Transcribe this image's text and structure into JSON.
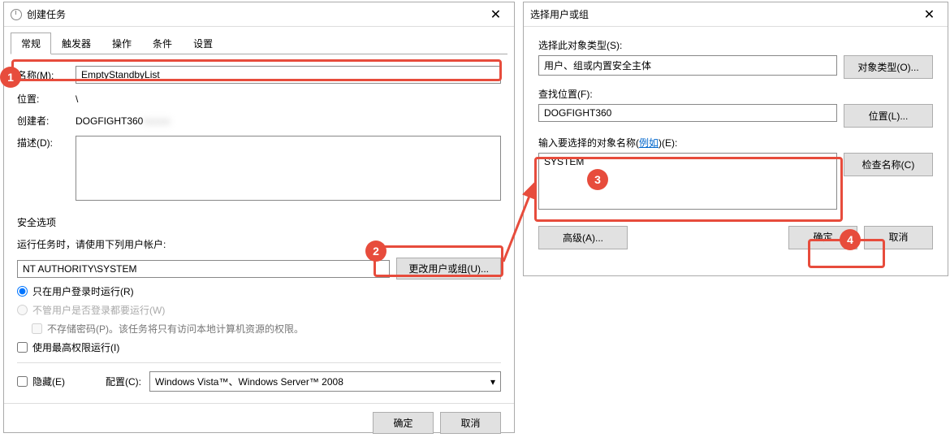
{
  "window1": {
    "title": "创建任务",
    "tabs": [
      "常规",
      "触发器",
      "操作",
      "条件",
      "设置"
    ],
    "labels": {
      "name": "名称(M):",
      "location": "位置:",
      "creator": "创建者:",
      "description": "描述(D):"
    },
    "values": {
      "name": "EmptyStandbyList",
      "location": "\\",
      "creator": "DOGFIGHT360",
      "creator_blur": "\\xxxxx"
    },
    "security": {
      "title": "安全选项",
      "runAsLabel": "运行任务时，请使用下列用户帐户:",
      "account": "NT AUTHORITY\\SYSTEM",
      "changeUserBtn": "更改用户或组(U)...",
      "radio1": "只在用户登录时运行(R)",
      "radio2": "不管用户是否登录都要运行(W)",
      "noStorePwd": "不存储密码(P)。该任务将只有访问本地计算机资源的权限。",
      "highestPriv": "使用最高权限运行(I)"
    },
    "hidden": "隐藏(E)",
    "configLabel": "配置(C):",
    "configValue": "Windows Vista™、Windows Server™ 2008",
    "ok": "确定",
    "cancel": "取消"
  },
  "window2": {
    "title": "选择用户或组",
    "objTypeLabel": "选择此对象类型(S):",
    "objTypeValue": "用户、组或内置安全主体",
    "objTypeBtn": "对象类型(O)...",
    "locLabel": "查找位置(F):",
    "locValue": "DOGFIGHT360",
    "locBtn": "位置(L)...",
    "nameLabel1": "输入要选择的对象名称(",
    "nameLabelLink": "例如",
    "nameLabel2": ")(E):",
    "nameValue": "SYSTEM",
    "checkBtn": "检查名称(C)",
    "advanced": "高级(A)...",
    "ok": "确定",
    "cancel": "取消"
  },
  "callouts": {
    "c1": "1",
    "c2": "2",
    "c3": "3",
    "c4": "4"
  }
}
